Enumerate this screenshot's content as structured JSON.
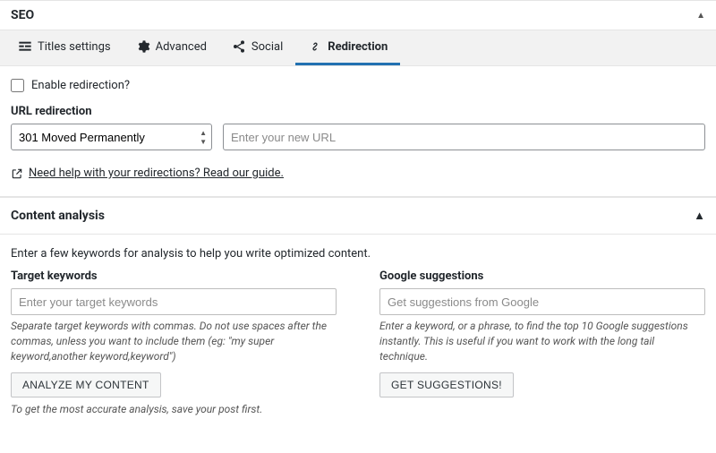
{
  "seo_panel": {
    "title": "SEO"
  },
  "tabs": {
    "titles": "Titles settings",
    "advanced": "Advanced",
    "social": "Social",
    "redirection": "Redirection"
  },
  "redirection": {
    "enable_label": "Enable redirection?",
    "url_label": "URL redirection",
    "select_value": "301 Moved Permanently",
    "url_placeholder": "Enter your new URL",
    "help_link": "Need help with your redirections? Read our guide."
  },
  "content_analysis": {
    "title": "Content analysis",
    "intro": "Enter a few keywords for analysis to help you write optimized content.",
    "target": {
      "label": "Target keywords",
      "placeholder": "Enter your target keywords",
      "help": "Separate target keywords with commas. Do not use spaces after the commas, unless you want to include them (eg: \"my super keyword,another keyword,keyword\")",
      "button": "ANALYZE MY CONTENT",
      "after": "To get the most accurate analysis, save your post first."
    },
    "google": {
      "label": "Google suggestions",
      "placeholder": "Get suggestions from Google",
      "help": "Enter a keyword, or a phrase, to find the top 10 Google suggestions instantly. This is useful if you want to work with the long tail technique.",
      "button": "GET SUGGESTIONS!"
    }
  }
}
